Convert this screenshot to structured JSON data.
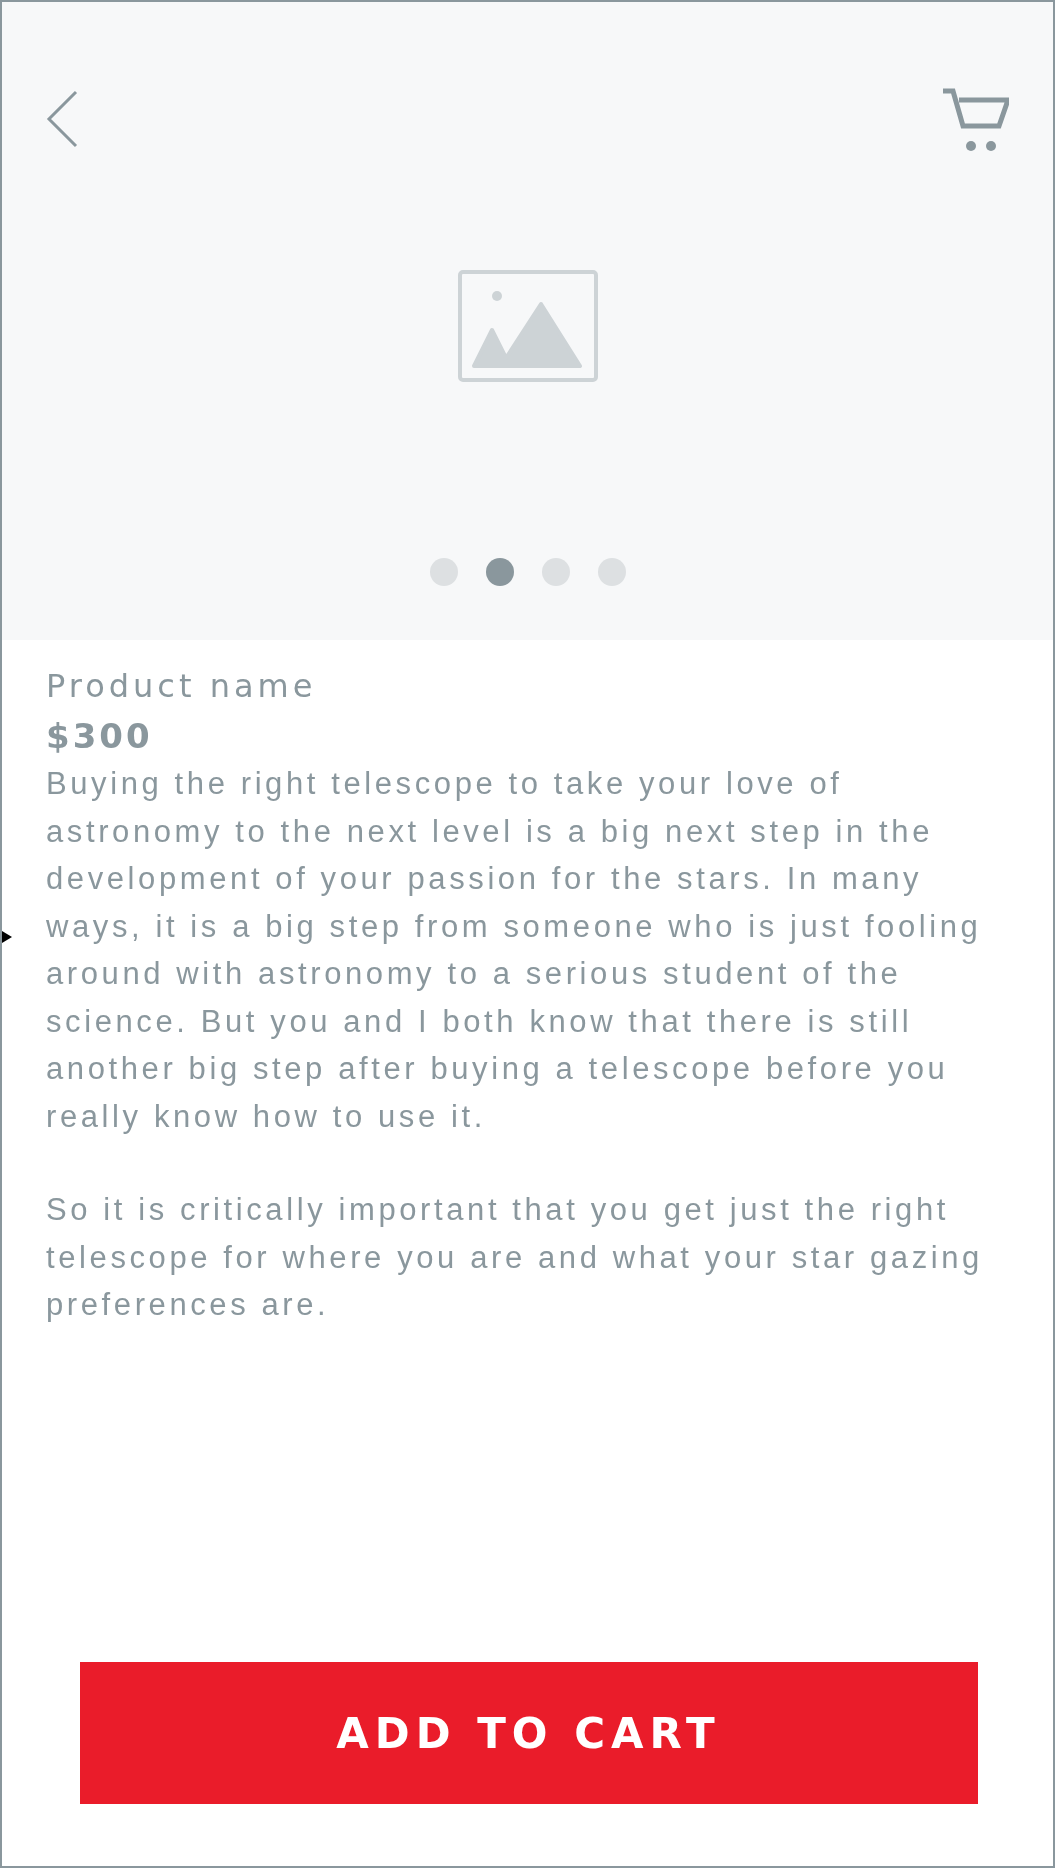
{
  "carousel": {
    "slides": [
      {
        "selected": false
      },
      {
        "selected": true
      },
      {
        "selected": false
      },
      {
        "selected": false
      }
    ]
  },
  "product": {
    "name": "Product name",
    "price": "$300",
    "description": [
      "Buying the right telescope to take your love of astronomy to the next level is a big next step in the development of your passion for the stars. In many ways, it is a big step from someone who is just fooling around with astronomy to a serious student of the science. But you and I both know that there is still another big step after buying a telescope before you really know how to use it.",
      "So it is critically important that you get just the right telescope for where you are and what your star gazing preferences are."
    ]
  },
  "button": "ADD TO CART"
}
